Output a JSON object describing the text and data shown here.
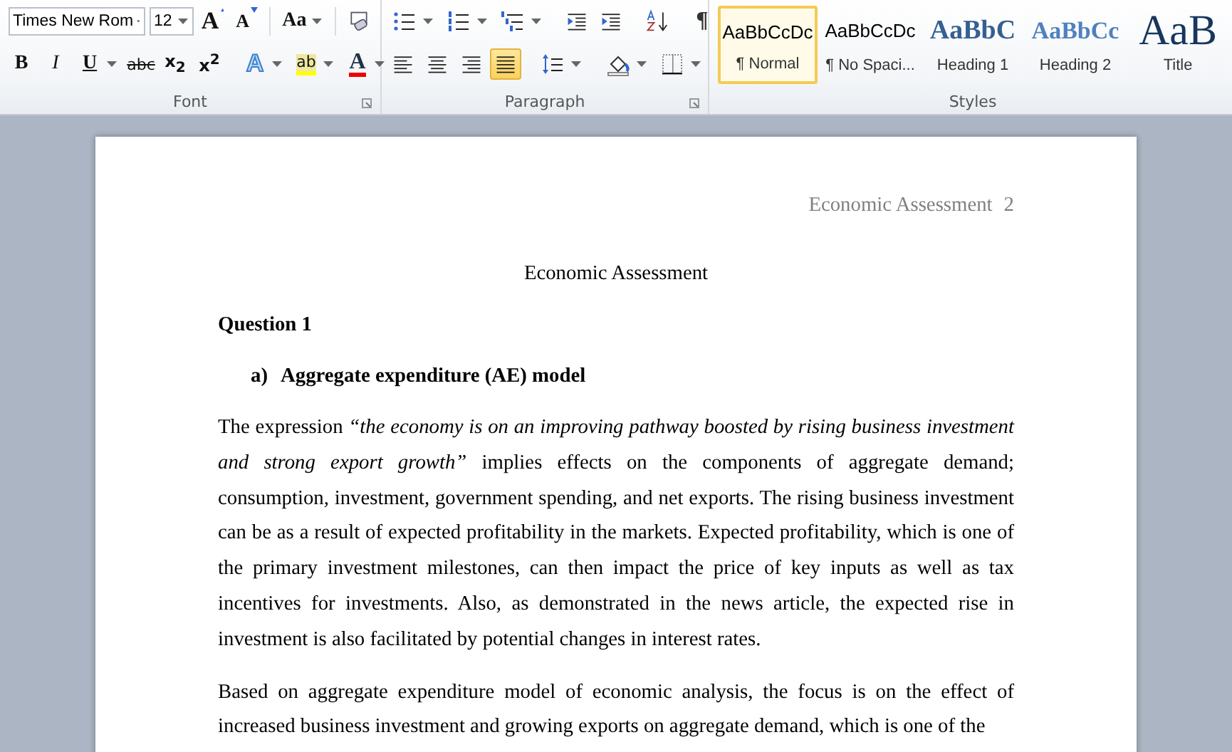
{
  "font": {
    "label": "Font",
    "family": "Times New Rom",
    "size": "12",
    "row1": [
      {
        "kind": "grow",
        "glyph": "A"
      },
      {
        "kind": "shrink",
        "glyph": "A"
      },
      {
        "kind": "case",
        "glyph": "Aa"
      },
      {
        "kind": "clear"
      }
    ],
    "row2": [
      {
        "kind": "bold",
        "glyph": "B"
      },
      {
        "kind": "italic",
        "glyph": "I"
      },
      {
        "kind": "underline",
        "glyph": "U"
      },
      {
        "kind": "strike",
        "glyph": "abc"
      },
      {
        "kind": "sub",
        "glyph": "x$_{2}$"
      },
      {
        "kind": "sup",
        "glyph": "x$^{2}$"
      },
      {
        "kind": "effects",
        "glyph": "A"
      },
      {
        "kind": "highlight",
        "glyph": "ab"
      },
      {
        "kind": "color",
        "glyph": "A"
      }
    ]
  },
  "paragraph": {
    "label": "Paragraph",
    "row1": [
      {
        "kind": "bullets"
      },
      {
        "kind": "numbering"
      },
      {
        "kind": "multilevel"
      },
      {
        "kind": "outdent"
      },
      {
        "kind": "indent"
      },
      {
        "kind": "sort"
      },
      {
        "kind": "marks",
        "glyph": "¶"
      }
    ],
    "row2": [
      {
        "kind": "align-left",
        "selected": false
      },
      {
        "kind": "align-center",
        "selected": false
      },
      {
        "kind": "align-right",
        "selected": false
      },
      {
        "kind": "justify",
        "selected": true
      },
      {
        "kind": "spacing"
      },
      {
        "kind": "shading"
      },
      {
        "kind": "borders"
      }
    ]
  },
  "styles": {
    "label": "Styles",
    "items": [
      {
        "preview": "AaBbCcDc",
        "name": "¶ Normal",
        "kind": "normal",
        "selected": true
      },
      {
        "preview": "AaBbCcDc",
        "name": "¶ No Spaci...",
        "kind": "normal",
        "selected": false
      },
      {
        "preview": "AaBbC",
        "name": "Heading 1",
        "kind": "heading1",
        "selected": false
      },
      {
        "preview": "AaBbCc",
        "name": "Heading 2",
        "kind": "heading2",
        "selected": false
      },
      {
        "preview": "AaB",
        "name": "Title",
        "kind": "title",
        "selected": false
      }
    ]
  },
  "document": {
    "header": "Economic Assessment",
    "page_number": "2",
    "blocks": [
      {
        "kind": "title",
        "text": "Economic Assessment"
      },
      {
        "kind": "heading",
        "text": "Question 1"
      },
      {
        "kind": "list-heading",
        "marker": "a)",
        "text": "Aggregate expenditure (AE) model"
      },
      {
        "kind": "paragraph",
        "text": "The expression *“the economy is on an improving pathway boosted by rising business investment and strong export growth”* implies effects on the components of aggregate demand; consumption, investment, government spending, and net exports. The rising business investment can be as a result of expected profitability in the markets. Expected profitability, which is one of the primary investment milestones, can then impact the price of key inputs as well as tax incentives for investments. Also, as demonstrated in the news article, the expected rise in investment is also facilitated by potential changes in interest rates."
      },
      {
        "kind": "paragraph",
        "text": "Based on aggregate expenditure model of economic analysis, the focus is on the effect of increased business investment and growing exports on aggregate demand, which is one of the"
      }
    ]
  }
}
